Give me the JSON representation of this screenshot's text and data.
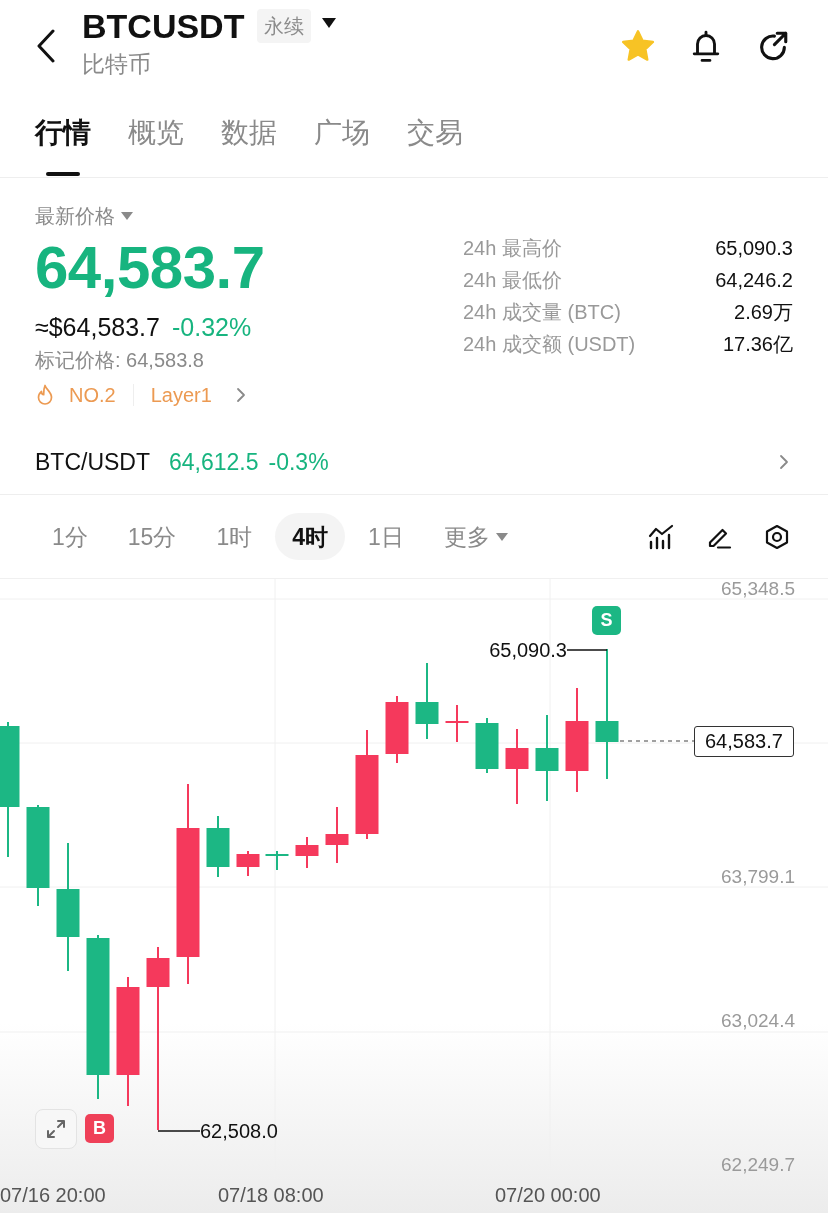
{
  "header": {
    "symbol": "BTCUSDT",
    "contract_type": "永续",
    "name": "比特币",
    "favorite": true
  },
  "tabs": [
    {
      "label": "行情",
      "selected": true
    },
    {
      "label": "概览",
      "selected": false
    },
    {
      "label": "数据",
      "selected": false
    },
    {
      "label": "广场",
      "selected": false
    },
    {
      "label": "交易",
      "selected": false
    }
  ],
  "price": {
    "label": "最新价格",
    "last": "64,583.7",
    "usd_value": "≈$64,583.7",
    "change": "-0.32%",
    "mark_price": "标记价格: 64,583.8",
    "tags": [
      {
        "kind": "hot",
        "text": "NO.2"
      },
      {
        "kind": "sector",
        "text": "Layer1"
      }
    ]
  },
  "stats": [
    {
      "label": "24h 最高价",
      "value": "65,090.3"
    },
    {
      "label": "24h 最低价",
      "value": "64,246.2"
    },
    {
      "label": "24h 成交量 (BTC)",
      "value": "2.69万"
    },
    {
      "label": "24h 成交额 (USDT)",
      "value": "17.36亿"
    }
  ],
  "spot": {
    "pair": "BTC/USDT",
    "price": "64,612.5",
    "change": "-0.3%"
  },
  "intervals": [
    {
      "kind": "interval",
      "label": "1分",
      "selected": false
    },
    {
      "kind": "interval",
      "label": "15分",
      "selected": false
    },
    {
      "kind": "interval",
      "label": "1时",
      "selected": false
    },
    {
      "kind": "interval",
      "label": "4时",
      "selected": true
    },
    {
      "kind": "interval",
      "label": "1日",
      "selected": false
    },
    {
      "kind": "menu",
      "label": "更多",
      "selected": false
    }
  ],
  "chart": {
    "y_axis": [
      "65,348.5",
      "63,799.1",
      "63,024.4",
      "62,249.7"
    ],
    "x_axis": [
      "07/16 20:00",
      "07/18 08:00",
      "07/20 00:00"
    ],
    "high": "65,090.3",
    "low": "62,508.0",
    "last_price": "64,583.7",
    "markers": [
      {
        "kind": "sell",
        "text": "S"
      },
      {
        "kind": "buy",
        "text": "B"
      }
    ]
  }
}
